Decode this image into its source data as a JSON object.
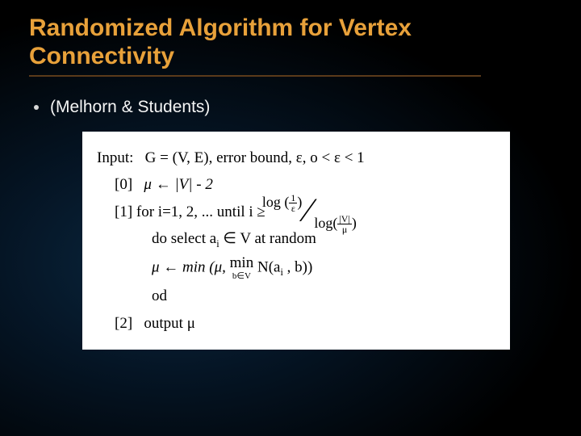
{
  "title": "Randomized Algorithm for Vertex Connectivity",
  "bullet": "(Melhorn & Students)",
  "algo": {
    "input_label": "Input:",
    "input_text": "G = (V, E), error bound, ε, o < ε < 1",
    "step0_tag": "[0]",
    "step0_body": "μ ← |V| - 2",
    "step1_tag": "[1]",
    "step1_for": "for i=1, 2, ... until i ≥",
    "frac_num_outer": "log (",
    "frac_num_inner_n": "1",
    "frac_num_inner_d": "ε",
    "frac_num_close": ")",
    "frac_den_outer": "log(",
    "frac_den_inner_n": "|V|",
    "frac_den_inner_d": "μ",
    "frac_den_close": ")",
    "do_select": "do select a",
    "do_select_sub": "i",
    "do_select_tail": " ∈ V at random",
    "mu_update_lhs": "μ ← min (μ,  ",
    "min_op": "min",
    "min_cond": "b∈V",
    "mu_update_rhs_a": " N(a",
    "mu_update_rhs_sub": "i",
    "mu_update_rhs_b": " , b))",
    "od": "od",
    "step2_tag": "[2]",
    "step2_body": "output μ"
  }
}
